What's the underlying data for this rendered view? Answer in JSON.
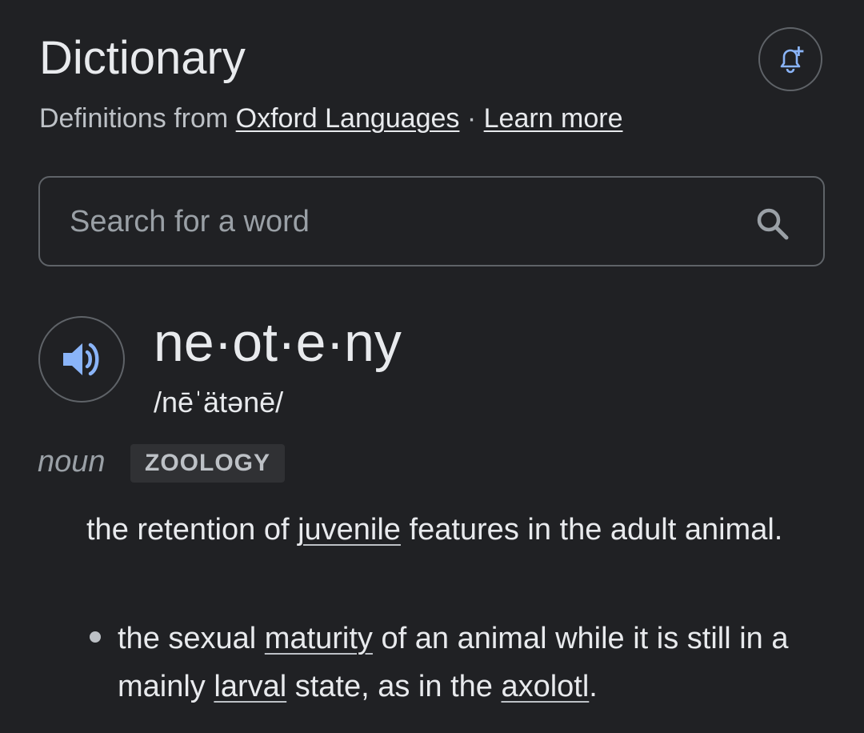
{
  "header": {
    "title": "Dictionary",
    "source_prefix": "Definitions from ",
    "source_link": "Oxford Languages",
    "separator": " · ",
    "learn_more": "Learn more"
  },
  "search": {
    "placeholder": "Search for a word"
  },
  "entry": {
    "headword": "ne·ot·e·ny",
    "phonetic": "/nēˈätənē/",
    "part_of_speech": "noun",
    "label": "ZOOLOGY",
    "definition": {
      "text_1": "the retention of ",
      "link_1": "juvenile",
      "text_2": " features in the adult animal."
    },
    "sub_definition": {
      "text_1": "the sexual ",
      "link_1": "maturity",
      "text_2": " of an animal while it is still in a mainly ",
      "link_2": "larval",
      "text_3": " state, as in the ",
      "link_3": "axolotl",
      "text_4": "."
    }
  },
  "icons": {
    "alert": "add-alert-icon",
    "search": "search-icon",
    "speaker": "speaker-icon"
  },
  "colors": {
    "background": "#202124",
    "accent_blue": "#8ab4f8",
    "text_primary": "#e8eaed",
    "text_secondary": "#9aa0a6",
    "border": "#5f6368"
  }
}
